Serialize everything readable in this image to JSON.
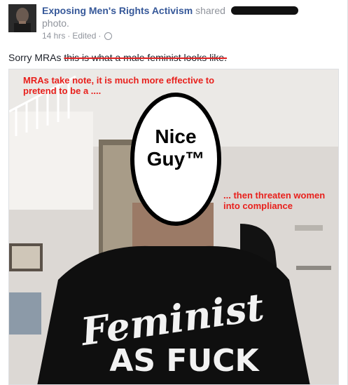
{
  "post": {
    "author": "Exposing Men's Rights Activism",
    "shared_text": "shared",
    "shared_object": "photo.",
    "timestamp": "14 hrs",
    "edited": "Edited",
    "caption_prefix": "Sorry MRAs",
    "caption_struck": "this is what a male feminist looks like."
  },
  "image": {
    "top_text": "MRAs take note, it is much more effective to pretend to be a ....",
    "face_label_line1": "Nice",
    "face_label_line2": "Guy™",
    "side_text": "... then threaten women into compliance",
    "shirt_text_line1": "Feminist",
    "shirt_text_line2": "AS FUCK"
  },
  "icons": {
    "avatar": "avatar",
    "privacy": "globe-icon"
  },
  "colors": {
    "link": "#365899",
    "meta": "#90949c",
    "overlay_red": "#e8201c"
  }
}
